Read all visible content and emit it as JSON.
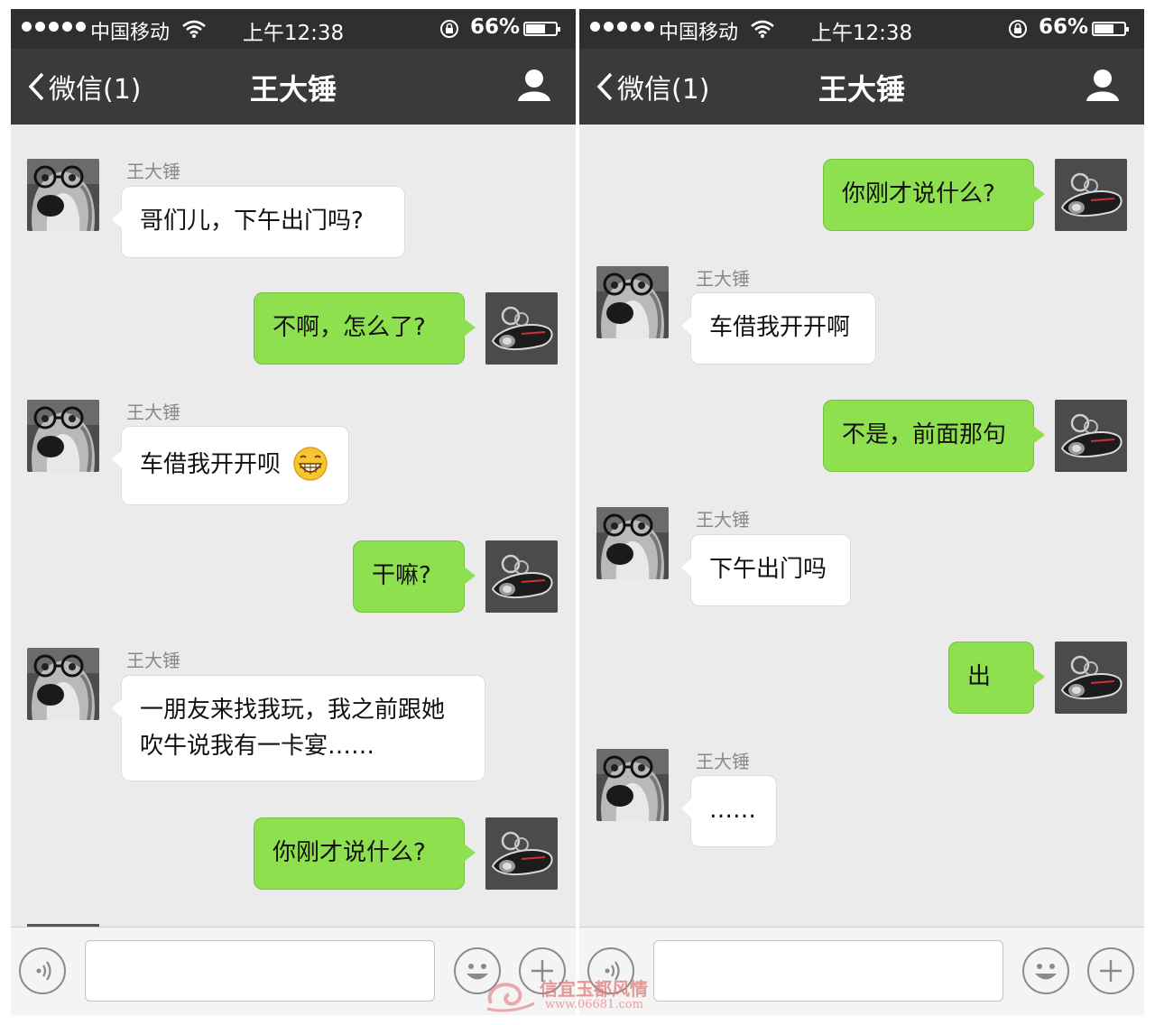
{
  "status_bar": {
    "carrier": "中国移动",
    "time": "上午12:38",
    "battery": "66%",
    "battery_level": 0.66
  },
  "nav": {
    "back_label": "微信(1)",
    "title": "王大锤"
  },
  "left_chat": {
    "messages": [
      {
        "side": "in",
        "sender": "王大锤",
        "text": "哥们儿，下午出门吗?"
      },
      {
        "side": "out",
        "text": "不啊，怎么了?"
      },
      {
        "side": "in",
        "sender": "王大锤",
        "text": "车借我开开呗",
        "emoji": "grinning-emoji"
      },
      {
        "side": "out",
        "text": "干嘛?"
      },
      {
        "side": "in",
        "sender": "王大锤",
        "line1": "一朋友来找我玩，我之前跟她",
        "line2": "吹牛说我有一卡宴……"
      },
      {
        "side": "out",
        "text": "你刚才说什么?"
      }
    ]
  },
  "right_chat": {
    "messages": [
      {
        "side": "out",
        "text": "你刚才说什么?"
      },
      {
        "side": "in",
        "sender": "王大锤",
        "text": "车借我开开啊"
      },
      {
        "side": "out",
        "text": "不是，前面那句"
      },
      {
        "side": "in",
        "sender": "王大锤",
        "text": "下午出门吗"
      },
      {
        "side": "out",
        "text": "出"
      },
      {
        "side": "in",
        "sender": "王大锤",
        "text": "……"
      }
    ]
  },
  "watermark": {
    "text": "信宜玉都风情",
    "url": "www.06681.com"
  },
  "colors": {
    "bar": "#2f2f30",
    "nav": "#3a3a3c",
    "chat_bg": "#ebebeb",
    "bubble_out": "#8ee04e",
    "bubble_in": "#ffffff"
  }
}
